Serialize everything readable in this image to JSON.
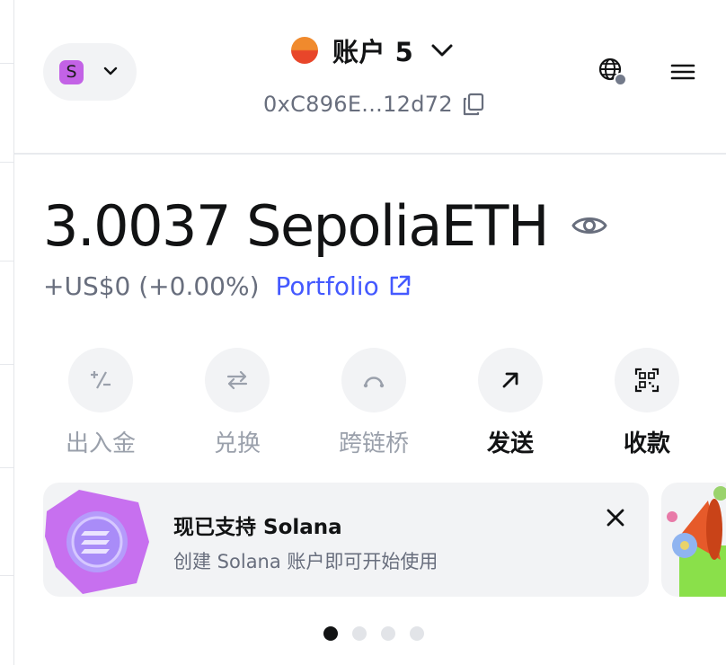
{
  "network": {
    "avatar_letter": "S",
    "avatar_color": "#c362e6"
  },
  "account": {
    "name": "账户 5",
    "address": "0xC896E...12d72"
  },
  "balance": {
    "amount": "3.0037 SepoliaETH",
    "change": "+US$0 (+0.00%)",
    "portfolio_label": "Portfolio"
  },
  "actions": [
    {
      "label": "出入金",
      "icon": "buy-sell-icon",
      "enabled": false
    },
    {
      "label": "兑换",
      "icon": "swap-icon",
      "enabled": false
    },
    {
      "label": "跨链桥",
      "icon": "bridge-icon",
      "enabled": false
    },
    {
      "label": "发送",
      "icon": "send-arrow-icon",
      "enabled": true
    },
    {
      "label": "收款",
      "icon": "qr-code-icon",
      "enabled": true
    }
  ],
  "banner": {
    "title": "现已支持 Solana",
    "subtitle": "创建 Solana 账户即可开始使用"
  },
  "carousel": {
    "total": 4,
    "active_index": 0
  },
  "colors": {
    "accent": "#4459ff",
    "muted": "#686e7d",
    "surface": "#f2f3f5",
    "text": "#121314"
  }
}
